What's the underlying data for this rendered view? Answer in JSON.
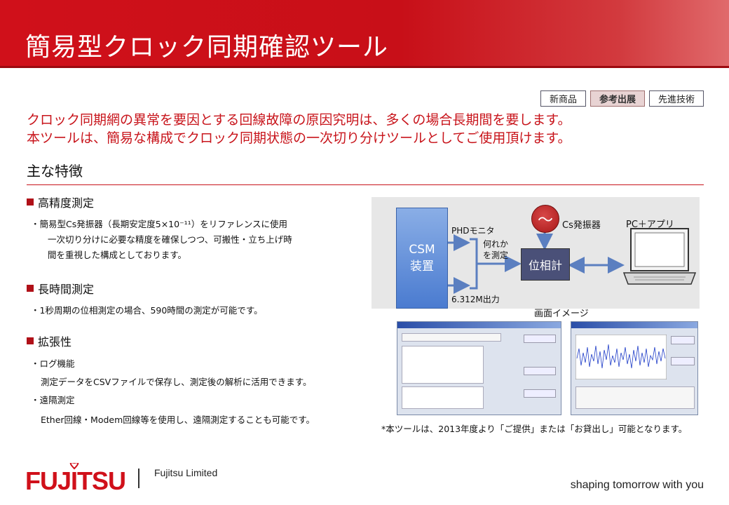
{
  "header": {
    "title": "簡易型クロック同期確認ツール"
  },
  "tags": [
    {
      "label": "新商品"
    },
    {
      "label": "参考出展"
    },
    {
      "label": "先進技術"
    }
  ],
  "lead": {
    "line1": "クロック同期網の異常を要因とする回線故障の原因究明は、多くの場合長期間を要します。",
    "line2": "本ツールは、簡易な構成でクロック同期状態の一次切り分けツールとしてご使用頂けます。"
  },
  "main_features_title": "主な特徴",
  "features": [
    {
      "title": "高精度測定",
      "lines": [
        "・簡易型Cs発振器（長期安定度5×10⁻¹¹）をリファレンスに使用",
        "一次切り分けに必要な精度を確保しつつ、可搬性・立ち上げ時",
        "間を重視した構成としております。"
      ]
    },
    {
      "title": "長時間測定",
      "lines": [
        "・1秒周期の位相測定の場合、590時間の測定が可能です。"
      ]
    },
    {
      "title": "拡張性",
      "lines": [
        "・ログ機能",
        "測定データをCSVファイルで保存し、測定後の解析に活用できます。",
        "・遠隔測定",
        "Ether回線・Modem回線等を使用し、遠隔測定することも可能です。"
      ]
    }
  ],
  "diagram": {
    "csm_line1": "CSM",
    "csm_line2": "装置",
    "phd_label": "PHDモニタ",
    "out_label": "6.312M出力",
    "measure_line1": "何れか",
    "measure_line2": "を測定",
    "phase_meter": "位相計",
    "cs_symbol": "～",
    "cs_label": "Cs発振器",
    "pc_label": "PC＋アプリ"
  },
  "screen_image_label": "画面イメージ",
  "footnote": "*本ツールは、2013年度より「ご提供」または「お貸出し」可能となります。",
  "footer": {
    "logo": "FUJITSU",
    "company": "Fujitsu Limited",
    "tagline": "shaping tomorrow with you"
  },
  "colors": {
    "brand_red": "#d0101a",
    "phase_meter": "#4a5078",
    "csm_blue": "#4a7bd0"
  }
}
